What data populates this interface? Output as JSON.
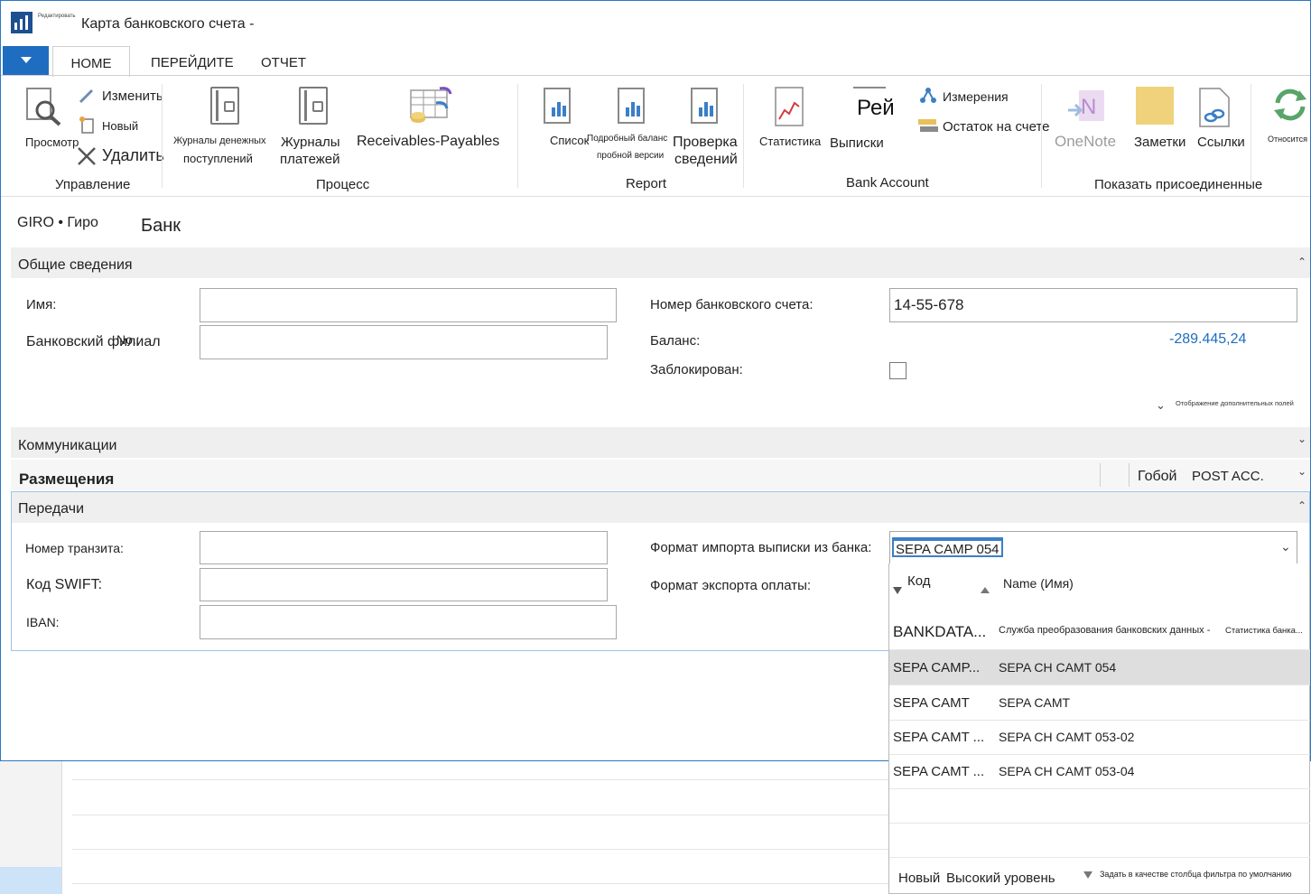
{
  "window": {
    "title": "Карта банковского счета -",
    "logo_caption": "Редактировать"
  },
  "tabs": {
    "home": "НОМЕ",
    "navigate": "ПЕРЕЙДИТЕ",
    "report": "ОТЧЕТ"
  },
  "ribbon": {
    "manage": {
      "view": "Просмотр",
      "edit": "Изменить",
      "new": "Новый",
      "delete": "Удалить",
      "group": "Управление"
    },
    "process": {
      "cash_journals_1": "Журналы денежных",
      "cash_journals_2": "поступлений",
      "payment_journals_1": "Журналы",
      "payment_journals_2": "платежей",
      "receivables": "Receivables-Payables",
      "group": "Процесс"
    },
    "report": {
      "list": "Список",
      "trial_1": "Подробный баланс",
      "trial_2": "пробной версии",
      "check_1": "Проверка",
      "check_2": "сведений",
      "group": "Report"
    },
    "bank_account": {
      "statistics": "Статистика",
      "statements_icon": "Рей",
      "statements": "Выписки",
      "dimensions": "Измерения",
      "balance": "Остаток на счете",
      "group": "Bank Account"
    },
    "attached": {
      "onenote": "OneNote",
      "notes": "Заметки",
      "links": "Ссылки",
      "refers": "Относится",
      "group": "Показать присоединенные"
    }
  },
  "header": {
    "code": "GIRO • Гиро",
    "name": "Банк"
  },
  "general": {
    "title": "Общие сведения",
    "name_label": "Имя:",
    "name_value": "",
    "branch_label": "Банковский филиал",
    "branch_overlay": "No.:",
    "branch_value": "",
    "account_no_label": "Номер банковского счета:",
    "account_no_value": "14-55-678",
    "balance_label": "Баланс:",
    "balance_value": "-289.445,24",
    "blocked_label": "Заблокирован:",
    "show_more": "Отображение дополнительных полей"
  },
  "communication": {
    "title": "Коммуникации"
  },
  "posting": {
    "title": "Размещения",
    "value1": "Гобой",
    "value2": "POST ACC."
  },
  "transfer": {
    "title": "Передачи",
    "transit_label": "Номер транзита:",
    "swift_label": "Код SWIFT:",
    "iban_label": "IBAN:",
    "import_label": "Формат импорта выписки из банка:",
    "import_value": "SEPA CAMP 054",
    "export_label": "Формат экспорта оплаты:"
  },
  "dropdown": {
    "col_code": "Код",
    "col_name": "Name (Имя)",
    "rows": [
      {
        "code": "BANKDATA...",
        "name": "Служба преобразования банковских данных -",
        "extra": "Статистика банка..."
      },
      {
        "code": "SEPA CAMP...",
        "name": "SEPA CH CAMT 054"
      },
      {
        "code": "SEPA CAMT",
        "name": "SEPA CAMT"
      },
      {
        "code": "SEPA CAMT ...",
        "name": "SEPA CH CAMT 053-02"
      },
      {
        "code": "SEPA CAMT ...",
        "name": "SEPA CH CAMT 053-04"
      }
    ],
    "footer_new": "Новый",
    "footer_level": "Высокий уровень",
    "footer_filter": "Задать в качестве столбца фильтра по умолчанию"
  },
  "colors": {
    "accent": "#1f6dc0",
    "balance": "#1f6dc0"
  }
}
